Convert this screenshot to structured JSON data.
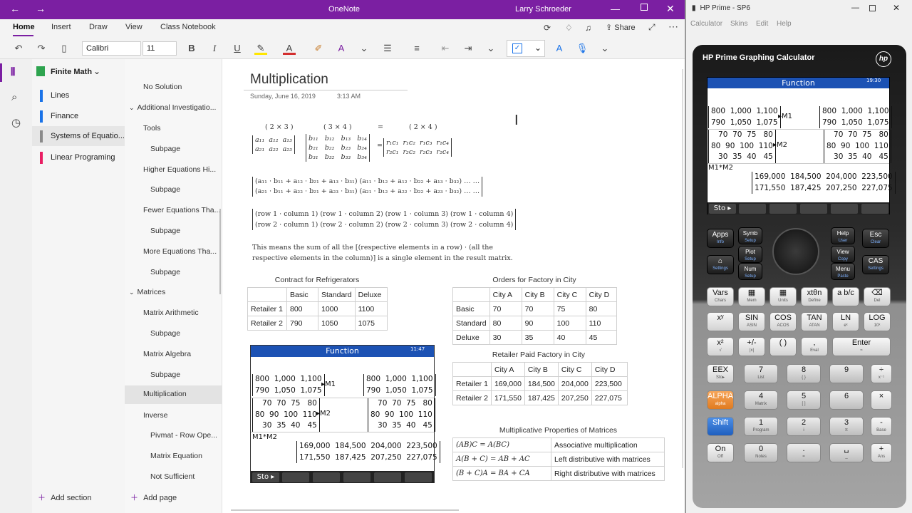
{
  "onenote": {
    "app_title": "OneNote",
    "user": "Larry Schroeder",
    "ribbon_tabs": [
      "Home",
      "Insert",
      "Draw",
      "View",
      "Class Notebook"
    ],
    "share_label": "Share",
    "font_name": "Calibri",
    "font_size": "11",
    "notebook_name": "Finite Math",
    "sections": [
      {
        "label": "Lines",
        "color": "#1a73e8"
      },
      {
        "label": "Finance",
        "color": "#1a73e8"
      },
      {
        "label": "Systems of Equatio...",
        "color": "#8a8a8a"
      },
      {
        "label": "Linear Programing",
        "color": "#e91e63"
      }
    ],
    "pages": [
      {
        "label": "No Solution",
        "level": 1
      },
      {
        "label": "Additional Investigatio...",
        "level": 0
      },
      {
        "label": "Tools",
        "level": 1
      },
      {
        "label": "Subpage",
        "level": 2
      },
      {
        "label": "Higher Equations Hi...",
        "level": 1
      },
      {
        "label": "Subpage",
        "level": 2
      },
      {
        "label": "Fewer Equations Tha...",
        "level": 1
      },
      {
        "label": "Subpage",
        "level": 2
      },
      {
        "label": "More Equations Tha...",
        "level": 1
      },
      {
        "label": "Subpage",
        "level": 2
      },
      {
        "label": "Matrices",
        "level": 0
      },
      {
        "label": "Matrix Arithmetic",
        "level": 1
      },
      {
        "label": "Subpage",
        "level": 2
      },
      {
        "label": "Matrix Algebra",
        "level": 1
      },
      {
        "label": "Subpage",
        "level": 2
      },
      {
        "label": "Multiplication",
        "level": 1
      },
      {
        "label": "Inverse",
        "level": 1
      },
      {
        "label": "Pivmat - Row Ope...",
        "level": 2
      },
      {
        "label": "Matrix Equation",
        "level": 2
      },
      {
        "label": "Not Sufficient",
        "level": 2
      }
    ],
    "add_section": "Add section",
    "add_page": "Add page",
    "page": {
      "title": "Multiplication",
      "date": "Sunday, June 16, 2019",
      "time": "3:13 AM",
      "dims": {
        "a": "( 2 × 3 )",
        "b": "( 3 × 4 )",
        "eq": "=",
        "c": "( 2 × 4 )"
      },
      "row_col_1": "(row 1 · column 1)  (row 1 · column 2)  (row 1 · column 3)  (row 1 · column 4)",
      "row_col_2": "(row 2 · column 1)  (row 2 · column 2)  (row 2 · column 3)  (row 2 · column 4)",
      "expand_1": "(a₁₁ · b₁₁ + a₁₂ · b₂₁ + a₁₃ · b₃₁)  (a₁₁ · b₁₂ + a₁₂ · b₂₂ + a₁₃ · b₃₂)  …  …",
      "expand_2": "(a₂₁ · b₁₁ + a₂₂ · b₂₁ + a₂₃ · b₃₁)  (a₂₁ · b₁₂ + a₂₂ · b₂₂ + a₂₃ · b₃₂)  …  …",
      "note": "This means the sum of all the [(respective elements in a row) · (all the respective elements in the column)] is a single element in the result matrix.",
      "refrig": {
        "caption": "Contract for Refrigerators",
        "header": [
          "",
          "Basic",
          "Standard",
          "Deluxe"
        ],
        "rows": [
          [
            "Retailer 1",
            "800",
            "1000",
            "1100"
          ],
          [
            "Retailer 2",
            "790",
            "1050",
            "1075"
          ]
        ]
      },
      "orders": {
        "caption": "Orders for Factory in City",
        "header": [
          "",
          "City A",
          "City B",
          "City C",
          "City D"
        ],
        "rows": [
          [
            "Basic",
            "70",
            "70",
            "75",
            "80"
          ],
          [
            "Standard",
            "80",
            "90",
            "100",
            "110"
          ],
          [
            "Deluxe",
            "30",
            "35",
            "40",
            "45"
          ]
        ]
      },
      "paid": {
        "caption": "Retailer Paid Factory in City",
        "header": [
          "",
          "City A",
          "City B",
          "City C",
          "City D"
        ],
        "rows": [
          [
            "Retailer 1",
            "169,000",
            "184,500",
            "204,000",
            "223,500"
          ],
          [
            "Retailer 2",
            "171,550",
            "187,425",
            "207,250",
            "227,075"
          ]
        ]
      },
      "props": {
        "caption": "Multiplicative Properties of Matrices",
        "rows": [
          [
            "(AB)C = A(BC)",
            "Associative multiplication"
          ],
          [
            "A(B + C) = AB + AC",
            "Left distributive with matrices"
          ],
          [
            "(B + C)A = BA + CA",
            "Right distributive with matrices"
          ]
        ]
      }
    }
  },
  "calc_screen": {
    "header": "Function",
    "clock": "11:47",
    "m1_rows": [
      "800  1,000  1,100",
      "790  1,050  1,075"
    ],
    "m2_rows": [
      "70  70  75   80",
      "80  90  100  110",
      "30  35  40   45"
    ],
    "m1_label": "▸M1",
    "m2_label": "▸M2",
    "product_label": "M1*M2",
    "result_rows": [
      "169,000  184,500  204,000  223,500",
      "171,550  187,425  207,250  227,075"
    ],
    "sto": "Sto ▸"
  },
  "hp": {
    "window_title": "HP Prime - SP6",
    "menu": [
      "Calculator",
      "Skins",
      "Edit",
      "Help"
    ],
    "brand": "HP Prime Graphing Calculator",
    "logo": "hp",
    "screen_header": "Function",
    "clock": "19:30",
    "keys_top": [
      {
        "main": "Apps",
        "sub": "Info"
      },
      {
        "main": "Symb",
        "sub": "Setup"
      },
      {
        "main": "Help",
        "sub": "User"
      },
      {
        "main": "Esc",
        "sub": "Clear"
      },
      {
        "main": "Plot",
        "sub": "Setup"
      },
      {
        "main": "View",
        "sub": "Copy"
      },
      {
        "main": "⌂",
        "sub": "Settings"
      },
      {
        "main": "Num",
        "sub": "Setup"
      },
      {
        "main": "Menu",
        "sub": "Paste"
      },
      {
        "main": "CAS",
        "sub": "Settings"
      }
    ],
    "keys": [
      [
        "Vars",
        "Chars",
        "▦",
        "Mem",
        "▦",
        "Units",
        "xtθn",
        "Define",
        "a b/c",
        "",
        "⌫",
        "Del"
      ],
      [
        "xʸ",
        "",
        "SIN",
        "ASIN",
        "COS",
        "ACOS",
        "TAN",
        "ATAN",
        "LN",
        "eˣ",
        "LOG",
        "10ˣ"
      ],
      [
        "x²",
        "√",
        "+/-",
        "|x|",
        "( )",
        "",
        "‚",
        "Eval",
        "Enter",
        "≈",
        "",
        ""
      ],
      [
        "EEX",
        "Sto▸",
        "7",
        "List",
        "8",
        "{ }",
        "9",
        "",
        "÷",
        "x⁻¹",
        "",
        ""
      ],
      [
        "ALPHA",
        "alpha",
        "4",
        "Matrix",
        "5",
        "[ ]",
        "6",
        "",
        "×",
        "",
        "",
        ""
      ],
      [
        "Shift",
        "",
        "1",
        "Program",
        "2",
        "i",
        "3",
        "π",
        "-",
        "Base",
        "",
        ""
      ],
      [
        "On",
        "Off",
        "0",
        "Notes",
        ".",
        "=",
        "␣",
        "_",
        "+",
        "Ans",
        "",
        ""
      ]
    ]
  }
}
